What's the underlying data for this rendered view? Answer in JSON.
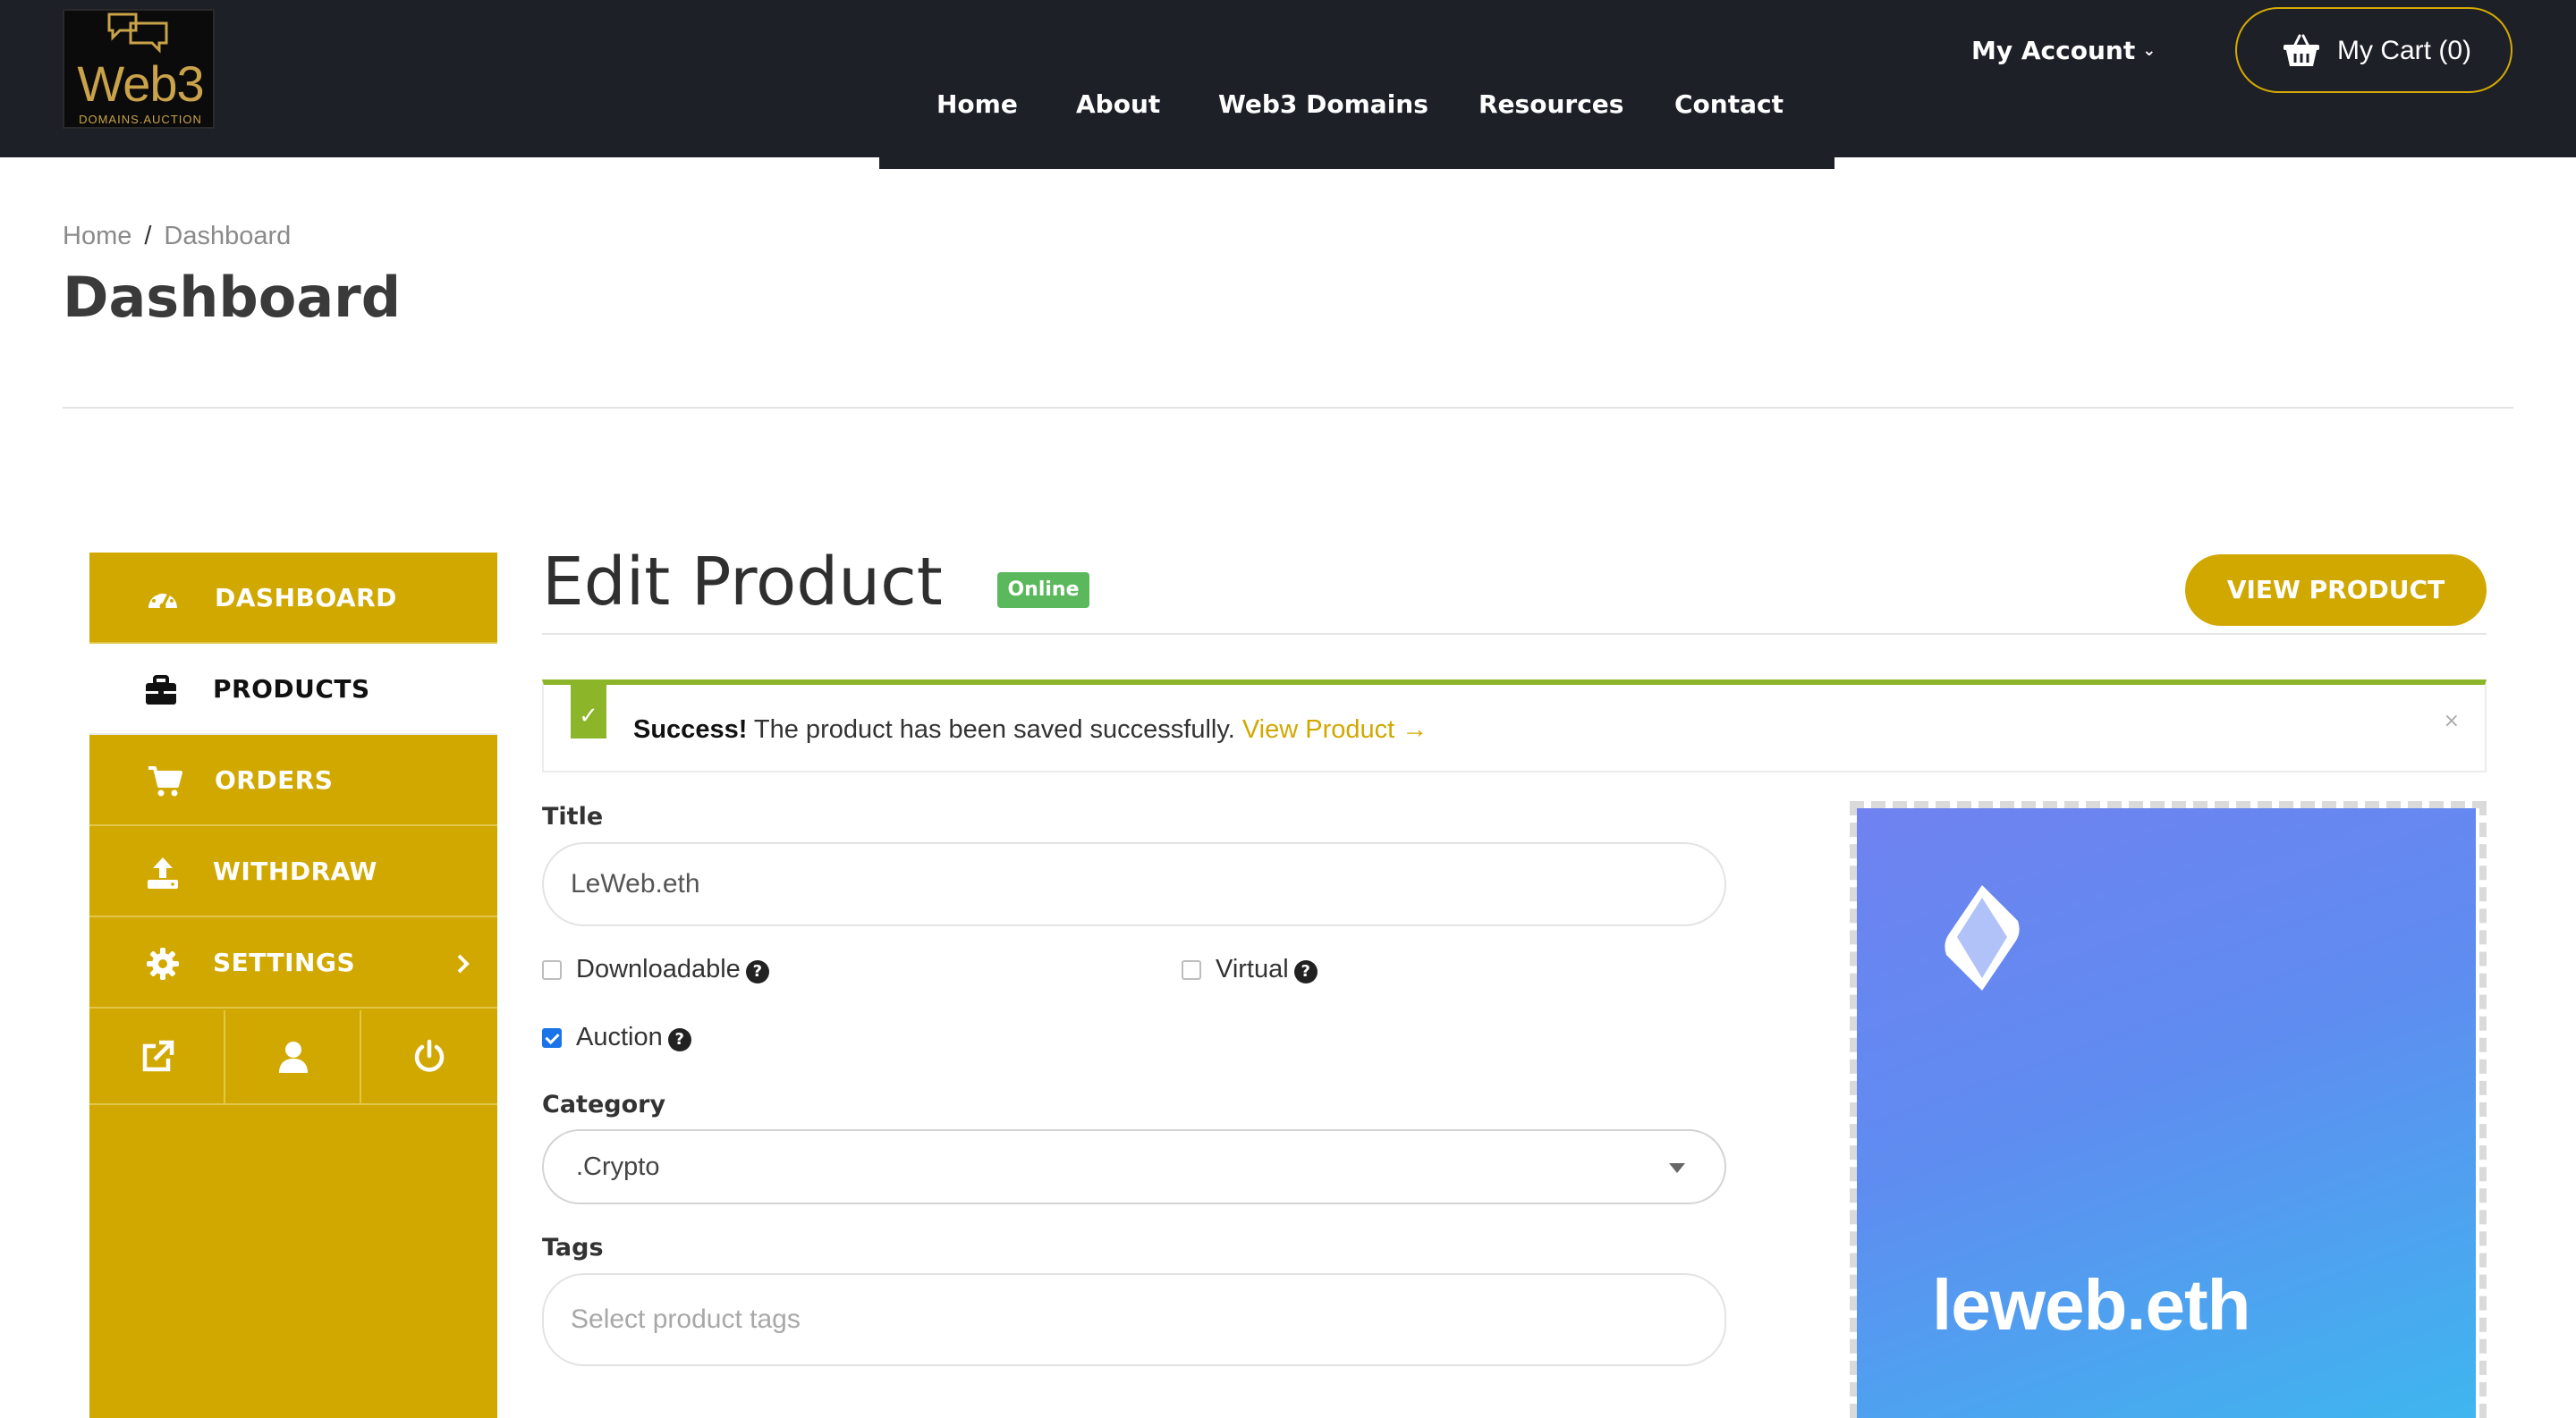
{
  "header": {
    "logo": {
      "word": "Web3",
      "sub": "DOMAINS.AUCTION"
    },
    "nav": [
      "Home",
      "About",
      "Web3 Domains",
      "Resources",
      "Contact"
    ],
    "account_label": "My Account",
    "cart_label": "My Cart (0)",
    "accent_color": "#d1a800"
  },
  "page": {
    "breadcrumb": [
      "Home",
      "Dashboard"
    ],
    "title": "Dashboard"
  },
  "sidebar": {
    "items": [
      {
        "label": "DASHBOARD",
        "icon": "speedometer-icon",
        "active": false
      },
      {
        "label": "PRODUCTS",
        "icon": "briefcase-icon",
        "active": true
      },
      {
        "label": "ORDERS",
        "icon": "cart-icon",
        "active": false
      },
      {
        "label": "WITHDRAW",
        "icon": "upload-icon",
        "active": false
      },
      {
        "label": "SETTINGS",
        "icon": "gear-icon",
        "active": false
      }
    ],
    "tools": [
      "external-link-icon",
      "user-icon",
      "power-icon"
    ]
  },
  "main": {
    "heading": "Edit Product",
    "status": "Online",
    "view_button": "VIEW PRODUCT",
    "alert": {
      "strong": "Success!",
      "message": "The product has been saved successfully.",
      "link": "View Product →",
      "close": "×"
    },
    "form": {
      "title_label": "Title",
      "title_value": "LeWeb.eth",
      "downloadable_label": "Downloadable",
      "downloadable_checked": false,
      "virtual_label": "Virtual",
      "virtual_checked": false,
      "auction_label": "Auction",
      "auction_checked": true,
      "category_label": "Category",
      "category_value": ".Crypto",
      "tags_label": "Tags",
      "tags_placeholder": "Select product tags"
    },
    "image": {
      "text": "leweb.eth",
      "logo": "ens-logo-icon"
    }
  }
}
